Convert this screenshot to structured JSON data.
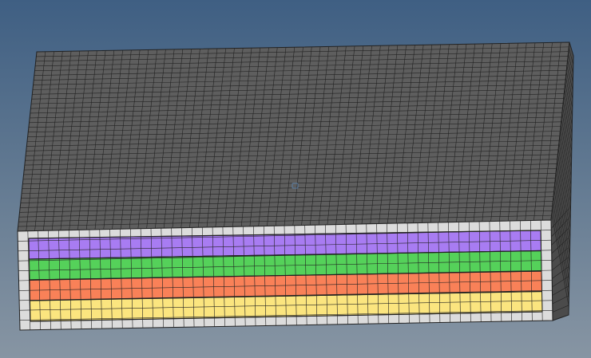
{
  "viewport": {
    "background_top": "#3f5f83",
    "background_bottom": "#8795a3"
  },
  "model": {
    "top_face_color": "#5e5e5e",
    "side_face_color": "#4b4b4b",
    "border_shell_color": "#dcdcdc",
    "mesh_line_color": "#222222",
    "layers": [
      {
        "name": "purple",
        "color": "#a87cf2"
      },
      {
        "name": "green",
        "color": "#55d15a"
      },
      {
        "name": "orange",
        "color": "#f98158"
      },
      {
        "name": "yellow",
        "color": "#fbe57f"
      }
    ],
    "top_mesh_columns": 62,
    "top_mesh_rows": 38,
    "front_mesh_columns": 52,
    "front_mesh_rows_per_layer": 2
  },
  "marker": {
    "icon": "view-center-marker-icon",
    "color": "#5a7da3"
  }
}
